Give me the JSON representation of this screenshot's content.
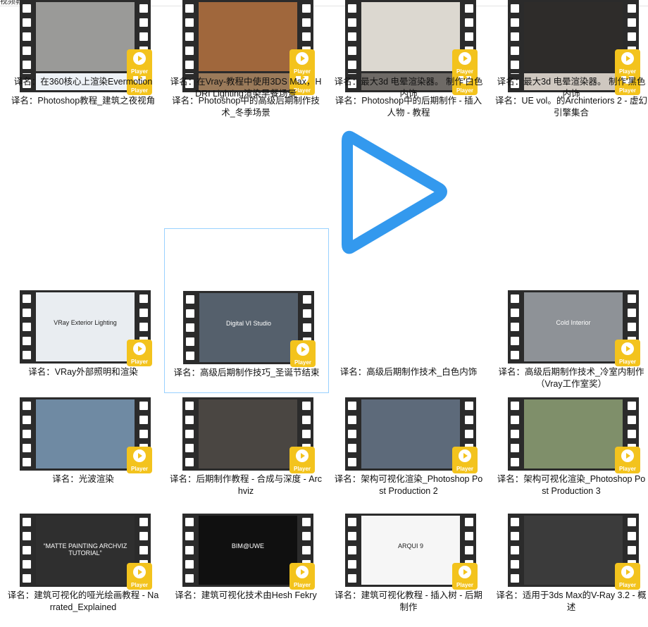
{
  "window": {
    "title": "视频教程"
  },
  "badge_label": "Player",
  "items": [
    {
      "caption": "译名：Photoshop教程_建筑之夜视角",
      "thumb": "",
      "bg": "#eef2f7",
      "icon": "video-thumbnail-icon"
    },
    {
      "caption": "译名：Photoshop中的高级后期制作技术_冬季场景",
      "thumb": "",
      "bg": "#9a7a5a",
      "icon": "video-thumbnail-icon"
    },
    {
      "caption": "译名：Photoshop中的后期制作 - 插入人物 - 教程",
      "thumb": "",
      "bg": "#6e6a66",
      "icon": "video-thumbnail-icon"
    },
    {
      "caption": "译名：UE vol。的Archinteriors 2 - 虚幻引擎集合",
      "thumb": "",
      "bg": "#cfc8c0",
      "icon": "video-thumbnail-icon"
    },
    {
      "caption": "",
      "thumb": "",
      "bg": "#ffffff",
      "icon": "blank-thumbnail-icon"
    },
    {
      "caption": "",
      "thumb": "",
      "bg": "#ffffff",
      "icon": "blank-thumbnail-icon"
    },
    {
      "caption": "",
      "thumb": "",
      "bg": "#ffffff",
      "icon": "blank-thumbnail-icon"
    },
    {
      "caption": "",
      "thumb": "",
      "bg": "#ffffff",
      "icon": "blank-thumbnail-icon"
    },
    {
      "caption": "译名：VRay外部照明和渲染",
      "thumb": "VRay Exterior Lighting",
      "bg": "#e9edf1",
      "icon": "video-thumbnail-icon"
    },
    {
      "caption": "译名：高级后期制作技巧_圣诞节结束",
      "thumb": "Digital VI Studio",
      "bg": "#55606c",
      "icon": "video-thumbnail-icon"
    },
    {
      "caption": "译名：高级后期制作技术_白色内饰",
      "thumb": "",
      "bg": "#ffffff",
      "icon": "play-icon"
    },
    {
      "caption": "译名：高级后期制作技术_冷室内制作（Vray工作室奖）",
      "thumb": "Cold Interior",
      "bg": "#8e9297",
      "icon": "video-thumbnail-icon"
    },
    {
      "caption": "译名：光波渲染",
      "thumb": "",
      "bg": "#6f8aa3",
      "icon": "video-thumbnail-icon"
    },
    {
      "caption": "译名：后期制作教程 - 合成与深度 - Archviz",
      "thumb": "",
      "bg": "#4a4642",
      "icon": "video-thumbnail-icon"
    },
    {
      "caption": "译名：架构可视化渲染_Photoshop Post Production 2",
      "thumb": "",
      "bg": "#5d6a7a",
      "icon": "video-thumbnail-icon"
    },
    {
      "caption": "译名：架构可视化渲染_Photoshop Post Production 3",
      "thumb": "",
      "bg": "#7f8f6a",
      "icon": "video-thumbnail-icon"
    },
    {
      "caption": "译名：建筑可视化的哑光绘画教程 - Narrated_Explained",
      "thumb": "“MATTE PAINTING ARCHVIZ TUTORIAL”",
      "bg": "#2f2f2f",
      "icon": "video-thumbnail-icon"
    },
    {
      "caption": "译名：建筑可视化技术由Hesh Fekry",
      "thumb": "BIM@UWE",
      "bg": "#101010",
      "icon": "video-thumbnail-icon"
    },
    {
      "caption": "译名：建筑可视化教程 - 插入树 - 后期制作",
      "thumb": "ARQUI 9",
      "bg": "#f6f6f6",
      "icon": "video-thumbnail-icon"
    },
    {
      "caption": "译名：适用于3ds Max的V-Ray 3.2 - 概述",
      "thumb": "",
      "bg": "#3b3b3b",
      "icon": "video-thumbnail-icon"
    },
    {
      "caption": "译名：在360核心上渲染Evermotion",
      "thumb": "",
      "bg": "#9a9a98",
      "icon": "video-thumbnail-icon"
    },
    {
      "caption": "译名：在Vray-教程中使用3DS Max，HDRI Lighting渲染早餐场景",
      "thumb": "",
      "bg": "#a0673c",
      "icon": "video-thumbnail-icon"
    },
    {
      "caption": "译名：最大3d 电晕渲染器。 制作'白色内饰",
      "thumb": "",
      "bg": "#dcd8d0",
      "icon": "video-thumbnail-icon"
    },
    {
      "caption": "译名：最大3d 电晕渲染器。 制作'黑色内饰",
      "thumb": "",
      "bg": "#2e2c2a",
      "icon": "video-thumbnail-icon"
    }
  ],
  "accent_color": "#3399ee"
}
